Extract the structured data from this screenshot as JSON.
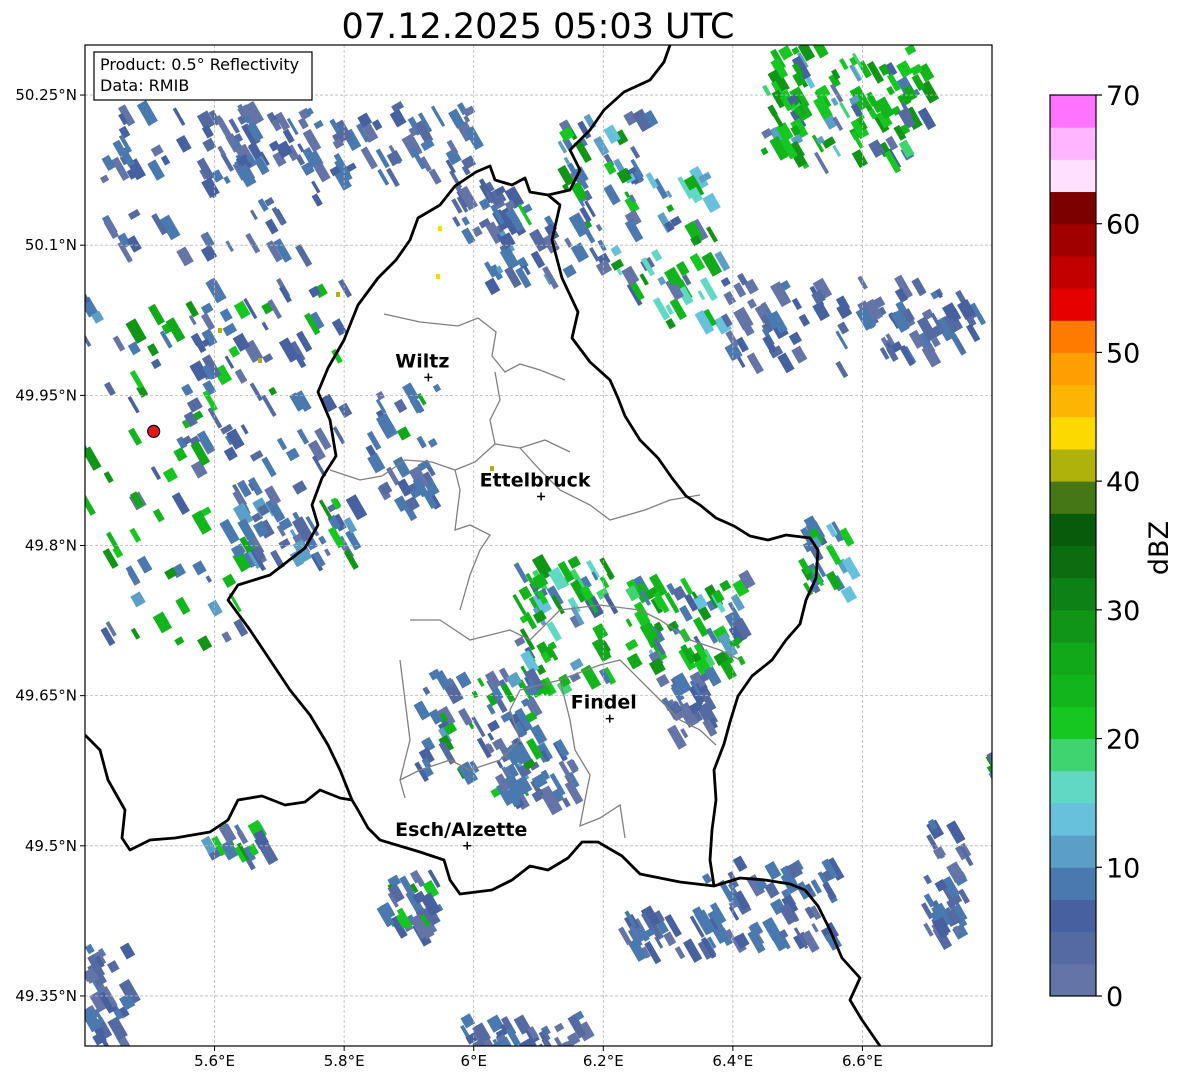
{
  "title": "07.12.2025 05:03 UTC",
  "info_box": {
    "product": "Product: 0.5° Reflectivity",
    "data": "Data: RMIB"
  },
  "map": {
    "lon_range": [
      5.4,
      6.8
    ],
    "lat_range": [
      49.3,
      50.3
    ],
    "grid": true,
    "lon_ticks": [
      {
        "value": 5.6,
        "label": "5.6°E"
      },
      {
        "value": 5.8,
        "label": "5.8°E"
      },
      {
        "value": 6.0,
        "label": "6°E"
      },
      {
        "value": 6.2,
        "label": "6.2°E"
      },
      {
        "value": 6.4,
        "label": "6.4°E"
      },
      {
        "value": 6.6,
        "label": "6.6°E"
      }
    ],
    "lat_ticks": [
      {
        "value": 50.25,
        "label": "50.25°N"
      },
      {
        "value": 50.1,
        "label": "50.1°N"
      },
      {
        "value": 49.95,
        "label": "49.95°N"
      },
      {
        "value": 49.8,
        "label": "49.8°N"
      },
      {
        "value": 49.65,
        "label": "49.65°N"
      },
      {
        "value": 49.5,
        "label": "49.5°N"
      },
      {
        "value": 49.35,
        "label": "49.35°N"
      }
    ],
    "cities": [
      {
        "name": "Wiltz",
        "lon": 5.93,
        "lat": 49.968
      },
      {
        "name": "Ettelbruck",
        "lon": 6.104,
        "lat": 49.849
      },
      {
        "name": "Findel",
        "lon": 6.21,
        "lat": 49.627
      },
      {
        "name": "Esch/Alzette",
        "lon": 5.99,
        "lat": 49.5
      }
    ],
    "radar_site": {
      "lon": 5.506,
      "lat": 49.914,
      "color": "#e8161a"
    }
  },
  "colorbar": {
    "label": "dBZ",
    "min": 0,
    "max": 70,
    "step": 2.5,
    "ticks": [
      "0",
      "10",
      "20",
      "30",
      "40",
      "50",
      "60",
      "70"
    ],
    "colors": [
      "#6474a6",
      "#546aa1",
      "#4761a0",
      "#4a79b0",
      "#5b9fc6",
      "#68c1dc",
      "#60d8c4",
      "#3fd46f",
      "#16c722",
      "#12b51c",
      "#11a81a",
      "#109517",
      "#0c8115",
      "#0b6c10",
      "#095b0c",
      "#457815",
      "#aeb20b",
      "#fcd901",
      "#fdb503",
      "#ff9e00",
      "#ff7c00",
      "#e60000",
      "#c30000",
      "#a00000",
      "#7d0000",
      "#ffe1ff",
      "#ffb5ff",
      "#ff73ff",
      "#eb3cee"
    ]
  }
}
